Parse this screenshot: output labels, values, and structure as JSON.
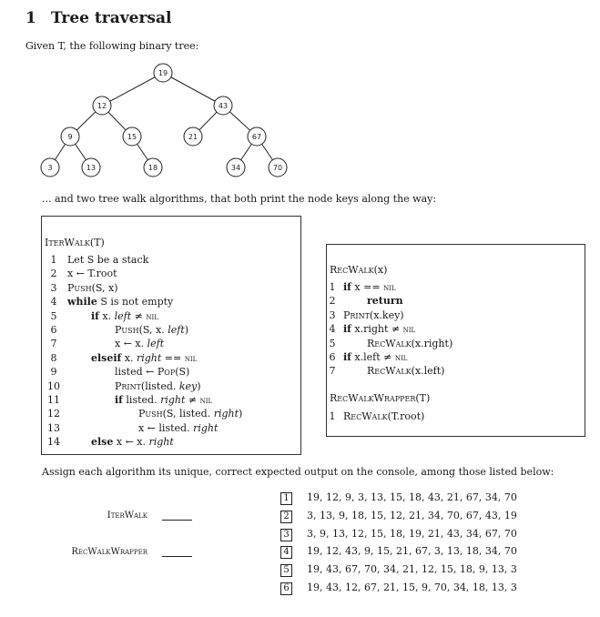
{
  "section": {
    "number": "1",
    "title": "Tree traversal"
  },
  "intro": "Given T, the following binary tree:",
  "tree": {
    "nodes": [
      {
        "key": "19"
      },
      {
        "key": "12"
      },
      {
        "key": "43"
      },
      {
        "key": "9"
      },
      {
        "key": "15"
      },
      {
        "key": "21"
      },
      {
        "key": "67"
      },
      {
        "key": "3"
      },
      {
        "key": "13"
      },
      {
        "key": "18"
      },
      {
        "key": "34"
      },
      {
        "key": "70"
      }
    ],
    "edges": [
      [
        "19",
        "12"
      ],
      [
        "19",
        "43"
      ],
      [
        "12",
        "9"
      ],
      [
        "12",
        "15"
      ],
      [
        "43",
        "21"
      ],
      [
        "43",
        "67"
      ],
      [
        "9",
        "3"
      ],
      [
        "9",
        "13"
      ],
      [
        "15",
        "18"
      ],
      [
        "67",
        "34"
      ],
      [
        "67",
        "70"
      ]
    ]
  },
  "algo_intro": "... and two tree walk algorithms, that both print the node keys along the way:",
  "iterwalk": {
    "title_name": "IterWalk",
    "title_args": "(T)",
    "lines": [
      {
        "n": "1",
        "text": "Let S be a stack"
      },
      {
        "n": "2",
        "text": "x ← T.root"
      },
      {
        "n": "3",
        "text": "Push(S, x)"
      },
      {
        "n": "4",
        "text": "while S is not empty"
      },
      {
        "n": "5",
        "text": "if x.left ≠ nil"
      },
      {
        "n": "6",
        "text": "Push(S, x.left)"
      },
      {
        "n": "7",
        "text": "x ← x.left"
      },
      {
        "n": "8",
        "text": "elseif x.right == nil"
      },
      {
        "n": "9",
        "text": "listed ← Pop(S)"
      },
      {
        "n": "10",
        "text": "Print(listed.key)"
      },
      {
        "n": "11",
        "text": "if listed.right ≠ nil"
      },
      {
        "n": "12",
        "text": "Push(S, listed.right)"
      },
      {
        "n": "13",
        "text": "x ← listed.right"
      },
      {
        "n": "14",
        "text": "else x ← x.right"
      }
    ]
  },
  "recwalk": {
    "title_name": "RecWalk",
    "title_args": "(x)",
    "lines": [
      {
        "n": "1",
        "text": "if x == nil"
      },
      {
        "n": "2",
        "text": "return"
      },
      {
        "n": "3",
        "text": "Print(x.key)"
      },
      {
        "n": "4",
        "text": "if x.right ≠ nil"
      },
      {
        "n": "5",
        "text": "RecWalk(x.right)"
      },
      {
        "n": "6",
        "text": "if x.left ≠ nil"
      },
      {
        "n": "7",
        "text": "RecWalk(x.left)"
      }
    ]
  },
  "wrapper": {
    "title_name": "RecWalkWrapper",
    "title_args": "(T)",
    "lines": [
      {
        "n": "1",
        "text": "RecWalk(T.root)"
      }
    ]
  },
  "assign_intro": "Assign each algorithm its unique, correct expected output on the console, among those listed below:",
  "answers": [
    {
      "label": "IterWalk",
      "value": ""
    },
    {
      "label": "RecWalkWrapper",
      "value": ""
    }
  ],
  "options": [
    {
      "num": "1",
      "seq": "19, 12, 9, 3, 13, 15, 18, 43, 21, 67, 34, 70"
    },
    {
      "num": "2",
      "seq": "3, 13, 9, 18, 15, 12, 21, 34, 70, 67, 43, 19"
    },
    {
      "num": "3",
      "seq": "3, 9, 13, 12, 15, 18, 19, 21, 43, 34, 67, 70"
    },
    {
      "num": "4",
      "seq": "19, 12, 43, 9, 15, 21, 67, 3, 13, 18, 34, 70"
    },
    {
      "num": "5",
      "seq": "19, 43, 67, 70, 34, 21, 12, 15, 18, 9, 13, 3"
    },
    {
      "num": "6",
      "seq": "19, 43, 12, 67, 21, 15, 9, 70, 34, 18, 13, 3"
    }
  ]
}
